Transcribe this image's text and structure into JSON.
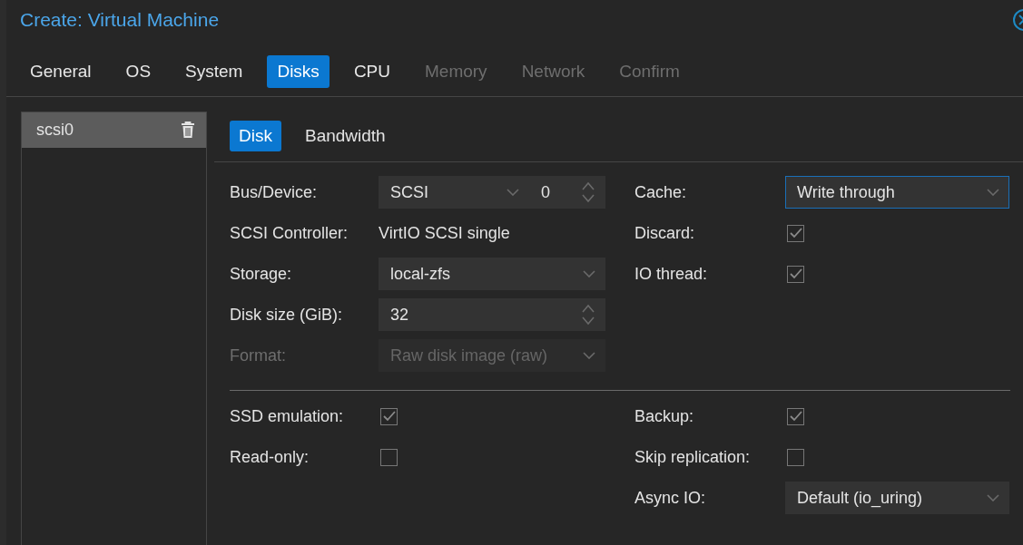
{
  "window": {
    "title": "Create: Virtual Machine"
  },
  "tabs": [
    {
      "label": "General",
      "selected": false,
      "disabled": false
    },
    {
      "label": "OS",
      "selected": false,
      "disabled": false
    },
    {
      "label": "System",
      "selected": false,
      "disabled": false
    },
    {
      "label": "Disks",
      "selected": true,
      "disabled": false
    },
    {
      "label": "CPU",
      "selected": false,
      "disabled": false
    },
    {
      "label": "Memory",
      "selected": false,
      "disabled": true
    },
    {
      "label": "Network",
      "selected": false,
      "disabled": true
    },
    {
      "label": "Confirm",
      "selected": false,
      "disabled": true
    }
  ],
  "disks": [
    {
      "label": "scsi0",
      "selected": true
    }
  ],
  "subtabs": [
    {
      "label": "Disk",
      "selected": true
    },
    {
      "label": "Bandwidth",
      "selected": false
    }
  ],
  "disk_form": {
    "left": [
      {
        "label": "Bus/Device:",
        "kind": "bus_device",
        "value": "SCSI",
        "number": "0"
      },
      {
        "label": "SCSI Controller:",
        "kind": "text",
        "value": "VirtIO SCSI single"
      },
      {
        "label": "Storage:",
        "kind": "select",
        "value": "local-zfs"
      },
      {
        "label": "Disk size (GiB):",
        "kind": "spinner",
        "value": "32"
      },
      {
        "label": "Format:",
        "kind": "select",
        "value": "Raw disk image (raw)",
        "disabled": true
      }
    ],
    "right": [
      {
        "label": "Cache:",
        "kind": "select",
        "value": "Write through",
        "focused": true
      },
      {
        "label": "Discard:",
        "kind": "checkbox",
        "checked": true,
        "disabled": false
      },
      {
        "label": "IO thread:",
        "kind": "checkbox",
        "checked": true,
        "disabled": false
      }
    ]
  },
  "options_form": {
    "left": [
      {
        "label": "SSD emulation:",
        "kind": "checkbox",
        "checked": true,
        "disabled": false
      },
      {
        "label": "Read-only:",
        "kind": "checkbox",
        "checked": false,
        "disabled": false
      }
    ],
    "right": [
      {
        "label": "Backup:",
        "kind": "checkbox",
        "checked": true,
        "disabled": false
      },
      {
        "label": "Skip replication:",
        "kind": "checkbox",
        "checked": false,
        "disabled": false
      },
      {
        "label": "Async IO:",
        "kind": "select",
        "value": "Default (io_uring)"
      }
    ]
  }
}
